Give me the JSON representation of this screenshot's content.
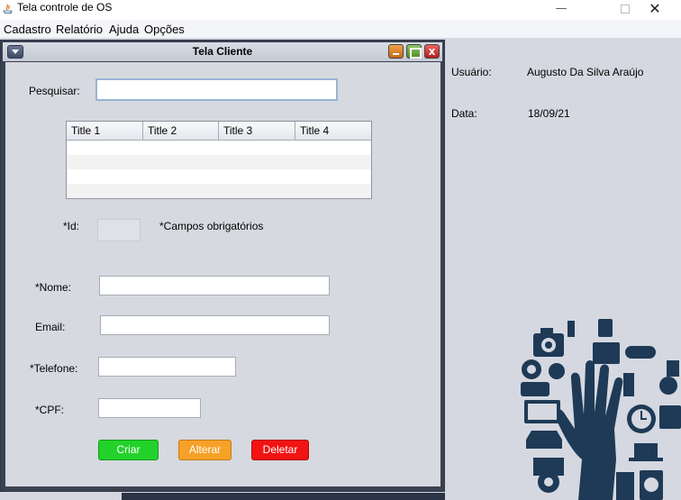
{
  "window": {
    "title": "Tela controle de OS",
    "controls": {
      "minimize": "—",
      "close": "✕"
    }
  },
  "menubar": [
    "Cadastro",
    "Relatório",
    "Ajuda",
    "Opções"
  ],
  "internal_frame": {
    "title": "Tela Cliente",
    "close_glyph": "x"
  },
  "form": {
    "search_label": "Pesquisar:",
    "search_value": "",
    "table": {
      "headers": [
        "Title 1",
        "Title 2",
        "Title 3",
        "Title 4"
      ],
      "rows": []
    },
    "id_label": "*Id:",
    "id_value": "",
    "required_note": "*Campos obrigatórios",
    "name_label": "*Nome:",
    "name_value": "",
    "email_label": "Email:",
    "email_value": "",
    "phone_label": "*Telefone:",
    "phone_value": "",
    "cpf_label": "*CPF:",
    "cpf_value": "",
    "buttons": {
      "create": "Criar",
      "edit": "Alterar",
      "delete": "Deletar"
    }
  },
  "info": {
    "user_label": "Usuário:",
    "user_value": "Augusto Da Silva Araújo",
    "date_label": "Data:",
    "date_value": "18/09/21"
  },
  "colors": {
    "create_button": "#22d22a",
    "edit_button": "#f7a128",
    "delete_button": "#f21313",
    "illustration": "#1e3a56",
    "desktop": "#d5d8e0"
  }
}
